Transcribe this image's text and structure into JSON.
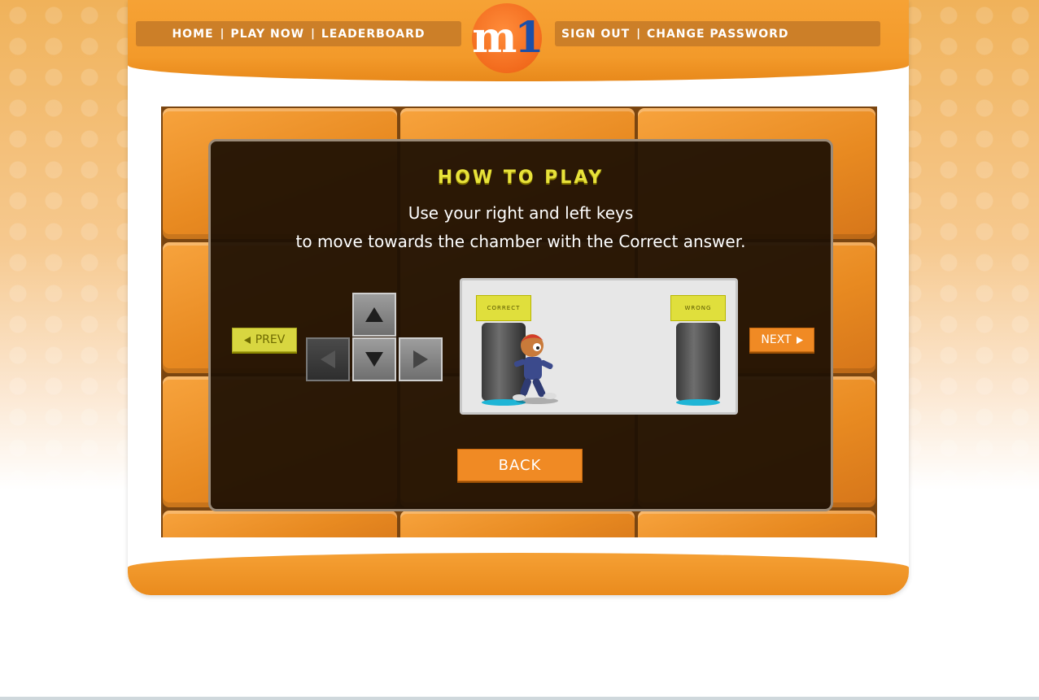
{
  "nav_left": {
    "home": "HOME",
    "play_now": "PLAY NOW",
    "leaderboard": "LEADERBOARD",
    "separator": "|"
  },
  "nav_right": {
    "sign_out": "SIGN OUT",
    "change_password": "CHANGE PASSWORD",
    "separator": "|"
  },
  "logo": {
    "text_m": "m",
    "text_1": "1"
  },
  "howto": {
    "title": "HOW TO PLAY",
    "line1": "Use your right and left keys",
    "line2": "to move towards the chamber with the Correct answer."
  },
  "buttons": {
    "prev": "PREV",
    "next": "NEXT",
    "back": "BACK"
  },
  "demo": {
    "sign_correct": "CORRECT",
    "sign_wrong": "WRONG"
  },
  "icons": [
    "arrow-up-key-icon",
    "arrow-left-key-icon",
    "arrow-down-key-icon",
    "arrow-right-key-icon",
    "prev-triangle-icon",
    "next-triangle-icon"
  ],
  "colors": {
    "accent_orange": "#f39a2a",
    "title_yellow": "#e8e23a",
    "prev_yellow": "#d8d640",
    "panel_dark": "#1c0f03"
  }
}
